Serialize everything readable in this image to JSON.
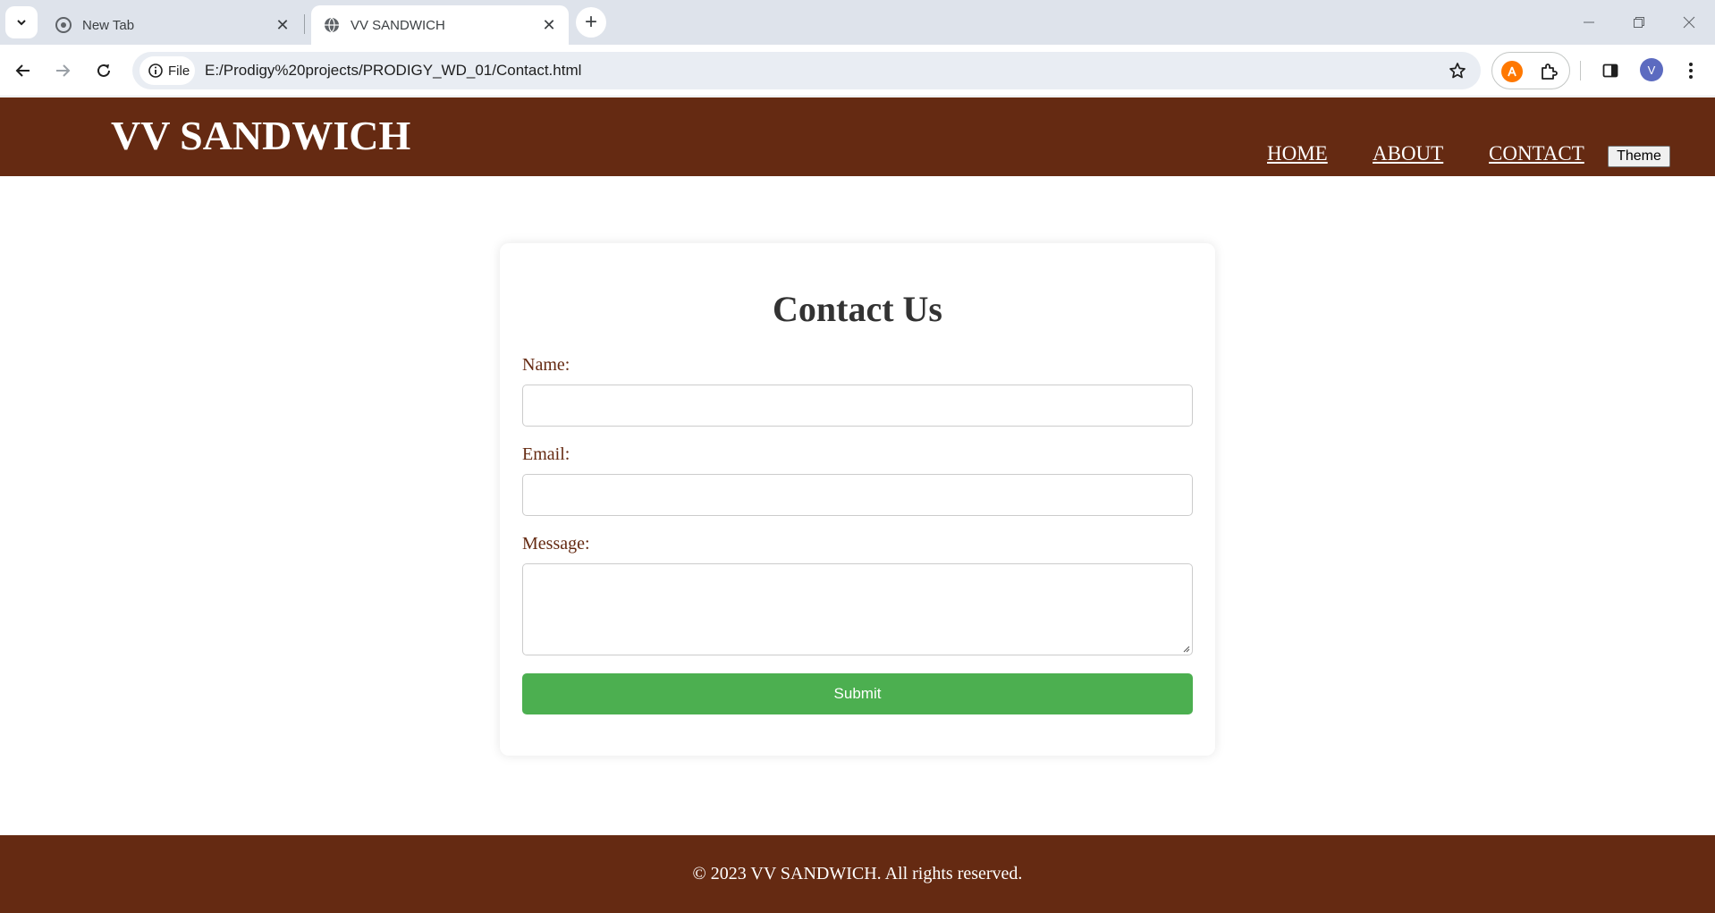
{
  "browser": {
    "tabs": [
      {
        "title": "New Tab",
        "active": false
      },
      {
        "title": "VV SANDWICH",
        "active": true
      }
    ],
    "site_chip_label": "File",
    "url": "E:/Prodigy%20projects/PRODIGY_WD_01/Contact.html",
    "profile_initial": "V"
  },
  "site": {
    "logo": "VV SANDWICH",
    "nav": {
      "home": "HOME",
      "about": "ABOUT",
      "contact": "CONTACT"
    },
    "theme_button": "Theme"
  },
  "form": {
    "title": "Contact Us",
    "name_label": "Name:",
    "email_label": "Email:",
    "message_label": "Message:",
    "name_value": "",
    "email_value": "",
    "message_value": "",
    "submit_label": "Submit"
  },
  "footer": {
    "text": "© 2023 VV SANDWICH. All rights reserved."
  },
  "colors": {
    "brand_brown": "#652a12",
    "submit_green": "#4caf50",
    "heading": "#333333"
  }
}
